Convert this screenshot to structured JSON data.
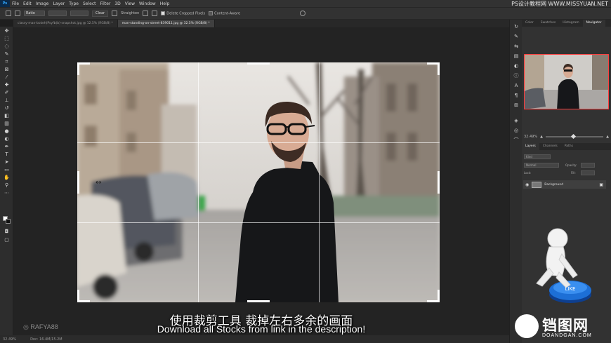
{
  "menubar": {
    "logo": "Ps",
    "items": [
      "File",
      "Edit",
      "Image",
      "Layer",
      "Type",
      "Select",
      "Filter",
      "3D",
      "View",
      "Window",
      "Help"
    ],
    "watermark": "PS设计教程网  WWW.MISSYUAN.NET"
  },
  "options": {
    "ratio": "Ratio",
    "clear_label": "Clear",
    "straighten_label": "Straighten",
    "delete_cropped_label": "Delete Cropped Pixels",
    "content_aware_label": "Content-Aware"
  },
  "tabs": [
    {
      "label": "classy-man-bokeh(Psyfb(b)-snapshot.jpg @ 12.5% (RGB/8) *",
      "active": false
    },
    {
      "label": "man-standing-on-street-839011.jpg @ 32.5% (RGB/8) *",
      "active": true
    }
  ],
  "panels": {
    "top_tabs": [
      "Color",
      "Swatches",
      "Histogram",
      "Navigator"
    ],
    "zoom": "32.49%",
    "zoom_level": 0.45,
    "layers_tabs": [
      "Layers",
      "Channels",
      "Paths"
    ],
    "kind_label": "Kind",
    "normal_label": "Normal",
    "opacity_label": "Opacity:",
    "lock_label": "Lock:",
    "fill_label": "Fill:",
    "layer_name": "Background"
  },
  "status": {
    "zoom": "32.49%",
    "doc": "Doc: 16.4M/15.2M"
  },
  "subtitles": {
    "cn": "使用裁剪工具  裁掉左右多余的画面",
    "en": "Download all Stocks from link in the description!"
  },
  "credit": "RAFYA88",
  "brand": {
    "cn": "铛图网",
    "en": "DOANDGAN.COM"
  },
  "mascot_label": "LIKE",
  "cursor_icon": "resize-horizontal-icon",
  "colors": {
    "crop_handle": "#ffffff",
    "nav_frame": "#ff3b3b",
    "like_button": "#1d6fd6"
  }
}
